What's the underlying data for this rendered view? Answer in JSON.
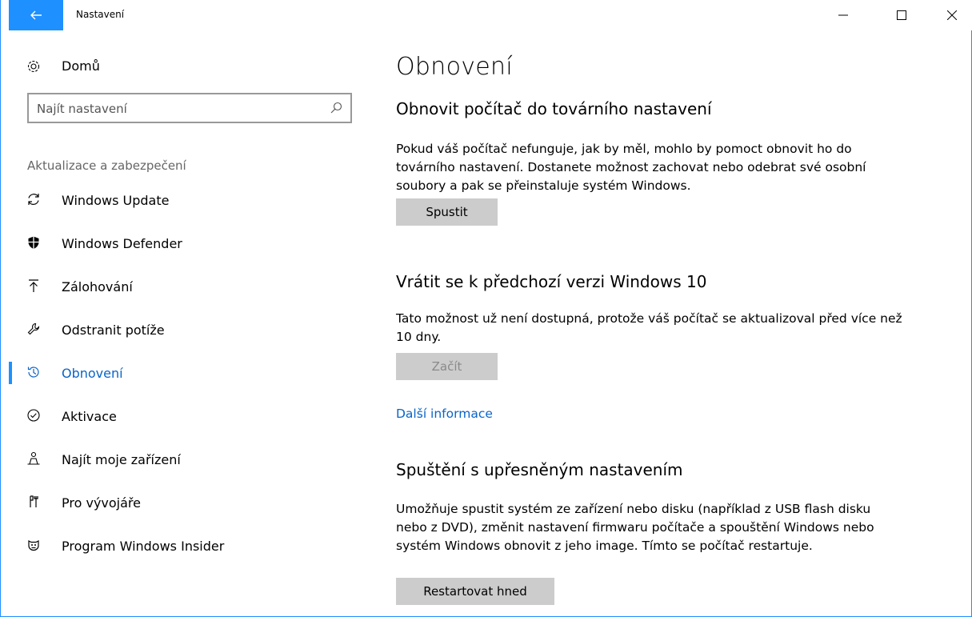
{
  "window": {
    "title": "Nastavení",
    "controls": [
      "minimize",
      "maximize",
      "close"
    ],
    "accent_color": "#1e90ff"
  },
  "sidebar": {
    "home_label": "Domů",
    "search_placeholder": "Najít nastavení",
    "section_header": "Aktualizace a zabezpečení",
    "items": [
      {
        "label": "Windows Update",
        "icon": "sync-icon",
        "active": false
      },
      {
        "label": "Windows Defender",
        "icon": "shield-icon",
        "active": false
      },
      {
        "label": "Zálohování",
        "icon": "upload-icon",
        "active": false
      },
      {
        "label": "Odstranit potíže",
        "icon": "wrench-icon",
        "active": false
      },
      {
        "label": "Obnovení",
        "icon": "history-icon",
        "active": true
      },
      {
        "label": "Aktivace",
        "icon": "check-circle-icon",
        "active": false
      },
      {
        "label": "Najít moje zařízení",
        "icon": "person-locate-icon",
        "active": false
      },
      {
        "label": "Pro vývojáře",
        "icon": "developer-tools-icon",
        "active": false
      },
      {
        "label": "Program Windows Insider",
        "icon": "insider-icon",
        "active": false
      }
    ]
  },
  "main": {
    "title": "Obnovení",
    "reset": {
      "heading": "Obnovit počítač do továrního nastavení",
      "description": "Pokud váš počítač nefunguje, jak by měl, mohlo by pomoct obnovit ho do továrního nastavení. Dostanete možnost zachovat nebo odebrat své osobní soubory a pak se přeinstaluje systém Windows.",
      "button_label": "Spustit"
    },
    "rollback": {
      "heading": "Vrátit se k předchozí verzi Windows 10",
      "description": "Tato možnost už není dostupná, protože váš počítač se aktualizoval před více než 10 dny.",
      "button_label": "Začít",
      "button_disabled": true
    },
    "more_info_link": "Další informace",
    "advanced": {
      "heading": "Spuštění s upřesněným nastavením",
      "description": "Umožňuje spustit systém ze zařízení nebo disku (například z USB flash disku nebo z DVD), změnit nastavení firmwaru počítače a spouštění Windows nebo systém Windows obnovit z jeho image. Tímto se počítač restartuje.",
      "button_label": "Restartovat hned"
    }
  }
}
